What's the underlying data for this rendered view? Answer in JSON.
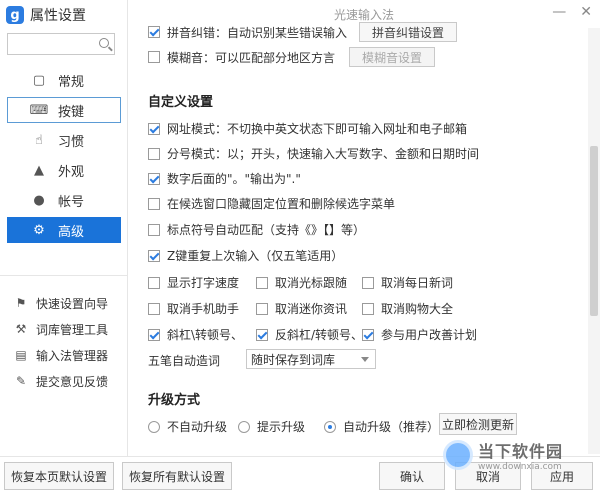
{
  "app": {
    "title": "属性设置",
    "window_title": "光速输入法"
  },
  "sidebar": {
    "search_placeholder": "",
    "items": [
      {
        "label": "常规",
        "icon": "monitor-icon"
      },
      {
        "label": "按键",
        "icon": "keyboard-icon"
      },
      {
        "label": "习惯",
        "icon": "thumb-icon"
      },
      {
        "label": "外观",
        "icon": "shirt-icon"
      },
      {
        "label": "帐号",
        "icon": "user-icon"
      },
      {
        "label": "高级",
        "icon": "gear-icon"
      }
    ],
    "tools": [
      {
        "label": "快速设置向导",
        "icon": "flag-icon"
      },
      {
        "label": "词库管理工具",
        "icon": "tools-icon"
      },
      {
        "label": "输入法管理器",
        "icon": "list-icon"
      },
      {
        "label": "提交意见反馈",
        "icon": "feedback-icon"
      }
    ]
  },
  "top_options": {
    "pinyin_correction": {
      "label": "拼音纠错：自动识别某些错误输入",
      "button": "拼音纠错设置",
      "checked": true
    },
    "fuzzy": {
      "label": "模糊音：可以匹配部分地区方言",
      "button": "模糊音设置",
      "checked": false
    }
  },
  "custom": {
    "title": "自定义设置",
    "options": [
      {
        "label": "网址模式：不切换中英文状态下即可输入网址和电子邮箱",
        "checked": true
      },
      {
        "label": "分号模式：以；开头，快速输入大写数字、金额和日期时间",
        "checked": false
      },
      {
        "label": "数字后面的\"。\"输出为\".\"",
        "checked": true
      },
      {
        "label": "在候选窗口隐藏固定位置和删除候选字菜单",
        "checked": false
      },
      {
        "label": "标点符号自动匹配（支持《》【】等）",
        "checked": false
      },
      {
        "label": "Z键重复上次输入（仅五笔适用）",
        "checked": true
      }
    ],
    "grid": [
      [
        {
          "label": "显示打字速度",
          "checked": false
        },
        {
          "label": "取消光标跟随",
          "checked": false
        },
        {
          "label": "取消每日新词",
          "checked": false
        }
      ],
      [
        {
          "label": "取消手机助手",
          "checked": false
        },
        {
          "label": "取消迷你资讯",
          "checked": false
        },
        {
          "label": "取消购物大全",
          "checked": false
        }
      ],
      [
        {
          "label": "斜杠\\转顿号、",
          "checked": true
        },
        {
          "label": "反斜杠/转顿号、",
          "checked": true
        },
        {
          "label": "参与用户改善计划",
          "checked": true
        }
      ]
    ],
    "wubi": {
      "label": "五笔自动造词",
      "value": "随时保存到词库"
    }
  },
  "upgrade": {
    "title": "升级方式",
    "options": [
      {
        "label": "不自动升级",
        "selected": false
      },
      {
        "label": "提示升级",
        "selected": false
      },
      {
        "label": "自动升级（推荐）",
        "selected": true
      }
    ],
    "check_button": "立即检测更新"
  },
  "footer": {
    "restore_page": "恢复本页默认设置",
    "restore_all": "恢复所有默认设置",
    "ok": "确认",
    "cancel": "取消",
    "apply": "应用"
  },
  "watermark": {
    "cn": "当下软件园",
    "en": "www.downxia.com"
  }
}
